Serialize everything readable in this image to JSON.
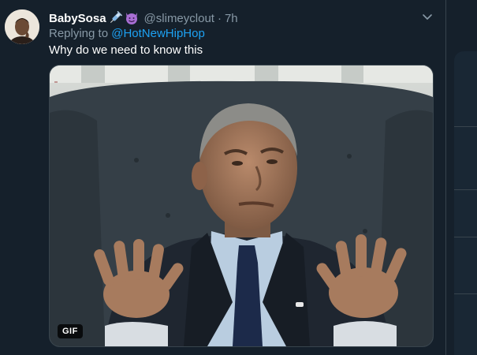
{
  "tweet": {
    "display_name": "BabySosa",
    "name_emojis": [
      "syringe-emoji",
      "smiling-imp-emoji"
    ],
    "handle": "@slimeyclout",
    "separator": "·",
    "time": "7h",
    "replying_prefix": "Replying to",
    "replying_to": "@HotNewHipHop",
    "text": "Why do we need to know this",
    "media": {
      "type": "gif",
      "badge": "GIF"
    }
  },
  "colors": {
    "background": "#15202b",
    "secondary_text": "#8899a6",
    "link": "#1da1f2",
    "border": "#38444d"
  }
}
